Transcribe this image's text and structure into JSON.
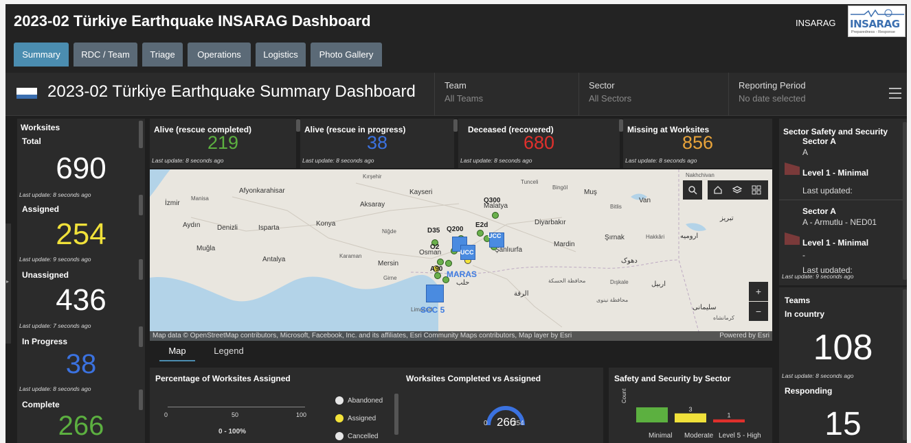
{
  "header": {
    "title": "2023-02 Türkiye Earthquake INSARAG Dashboard",
    "org_label": "INSARAG",
    "logo_text": "INSARAG",
    "logo_tagline": "Preparedness - Response"
  },
  "tabs": [
    {
      "label": "Summary",
      "active": true
    },
    {
      "label": "RDC / Team",
      "active": false
    },
    {
      "label": "Triage",
      "active": false
    },
    {
      "label": "Operations",
      "active": false
    },
    {
      "label": "Logistics",
      "active": false
    },
    {
      "label": "Photo Gallery",
      "active": false
    }
  ],
  "summary": {
    "title": "2023-02 Türkiye Earthquake Summary Dashboard",
    "filters": [
      {
        "label": "Team",
        "value": "All Teams"
      },
      {
        "label": "Sector",
        "value": "All Sectors"
      },
      {
        "label": "Reporting Period",
        "value": "No date selected"
      }
    ]
  },
  "worksites": {
    "title": "Worksites",
    "items": [
      {
        "label": "Total",
        "value": "690",
        "updated": "Last update: 8 seconds ago",
        "color": "#ffffff"
      },
      {
        "label": "Assigned",
        "value": "254",
        "updated": "Last update: 9 seconds ago",
        "color": "#f0e13a"
      },
      {
        "label": "Unassigned",
        "value": "436",
        "updated": "Last update: 7 seconds ago",
        "color": "#ffffff"
      },
      {
        "label": "In Progress",
        "value": "38",
        "updated": "Last update: 8 seconds ago",
        "color": "#3b72e0"
      },
      {
        "label": "Complete",
        "value": "266",
        "updated": "",
        "color": "#5cb040"
      }
    ]
  },
  "stats": [
    {
      "label": "Alive (rescue completed)",
      "value": "219",
      "updated": "Last update: 8 seconds ago",
      "color": "#5cb040"
    },
    {
      "label": "Alive (rescue in progress)",
      "value": "38",
      "updated": "Last update: 8 seconds ago",
      "color": "#3b72e0"
    },
    {
      "label": "Deceased (recovered)",
      "value": "680",
      "updated": "Last update: 8 seconds ago",
      "color": "#e0302c"
    },
    {
      "label": "Missing at Worksites",
      "value": "856",
      "updated": "Last update: 8 seconds ago",
      "color": "#e8a33a"
    }
  ],
  "map": {
    "labels": [
      "Kırşehir",
      "Tunceli",
      "Bingöl",
      "Muş",
      "Nakhchivan",
      "Afyonkarahisar",
      "Kayseri",
      "Malatya",
      "Bitlis",
      "Van",
      "İzmir",
      "Manisa",
      "Aksaray",
      "Aydın",
      "Denizli",
      "Isparta",
      "Konya",
      "Niğde",
      "Diyarbakır",
      "تبریز",
      "Muğla",
      "Antalya",
      "Karaman",
      "Mersin",
      "Osman",
      "Şanlıurfa",
      "Mardin",
      "Şırnak",
      "Hakkâri",
      "ارومیه",
      "دهوک",
      "محافظة الحسكة",
      "حلب",
      "اربیل",
      "الرقة",
      "سلیمانی",
      "Dışkale",
      "کرمانشاه",
      "محافظة نينوى",
      "Girne",
      "Limassol"
    ],
    "site_labels": [
      "Q300",
      "D35",
      "Q200",
      "E2d",
      "O2",
      "A90",
      "MARAS",
      "SCC 5",
      "UCC",
      "UCC"
    ],
    "attribution": "Map data © OpenStreetMap contributors, Microsoft, Facebook, Inc. and its affiliates, Esri Community Maps contributors, Map layer by Esri",
    "powered_by": "Powered by Esri",
    "tabs": [
      "Map",
      "Legend"
    ]
  },
  "pct_panel": {
    "title": "Percentage of Worksites Assigned",
    "ticks": [
      "0",
      "50",
      "100"
    ],
    "range_label": "0 - 100%",
    "legend": [
      {
        "label": "Abandoned",
        "color": "#e6e6e6"
      },
      {
        "label": "Assigned",
        "color": "#f3e33a"
      },
      {
        "label": "Cancelled",
        "color": "#e6e6e6"
      }
    ]
  },
  "completed_panel": {
    "title": "Worksites Completed vs Assigned",
    "gauge_value": "266",
    "gauge_min": "0",
    "gauge_max": "254",
    "accent": "#3b72e0"
  },
  "safety_panel": {
    "title": "Safety and Security by Sector",
    "axis_label": "Count",
    "chart_data": {
      "type": "bar",
      "categories": [
        "Minimal",
        "Moderate",
        "Level 5 - High"
      ],
      "values": [
        5,
        3,
        1
      ],
      "colors": [
        "#5cb040",
        "#f0e13a",
        "#e0302c"
      ]
    }
  },
  "sector_panel": {
    "title": "Sector Safety and Security",
    "items": [
      {
        "sector": "Sector A",
        "detail": "A",
        "level": "Level 1 - Minimal",
        "updated": "Last updated:"
      },
      {
        "sector": "Sector A",
        "detail": "A - Armutlu - NED01",
        "level": "Level 1 - Minimal",
        "dash": "-",
        "updated": "Last updated:"
      }
    ],
    "footer": "Last update: 9 seconds ago"
  },
  "teams_panel": {
    "title": "Teams",
    "items": [
      {
        "label": "In country",
        "value": "108",
        "updated": "Last update: 8 seconds ago"
      },
      {
        "label": "Responding",
        "value": "15"
      }
    ]
  }
}
